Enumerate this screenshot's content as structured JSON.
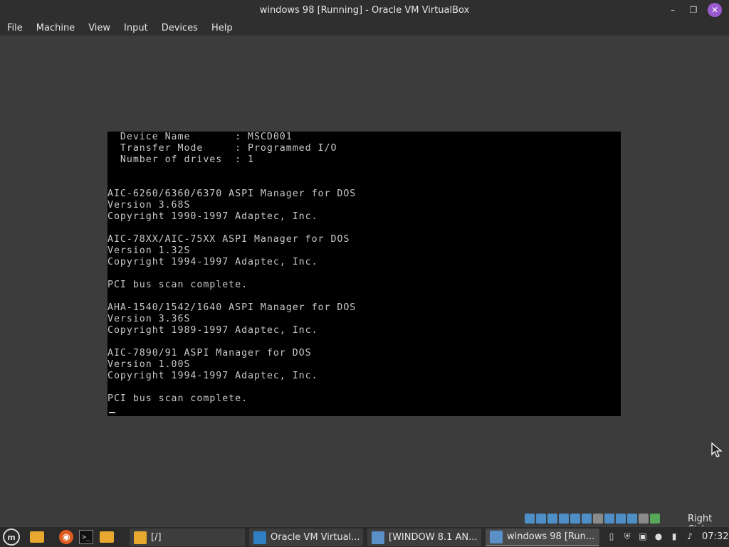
{
  "window": {
    "title": "windows 98 [Running] - Oracle VM VirtualBox",
    "minimize_glyph": "–",
    "maximize_glyph": "❐",
    "close_glyph": "✕"
  },
  "menu": [
    "File",
    "Machine",
    "View",
    "Input",
    "Devices",
    "Help"
  ],
  "dos_console": {
    "lines": [
      "  Device Name       : MSCD001",
      "  Transfer Mode     : Programmed I/O",
      "  Number of drives  : 1",
      "",
      "",
      "AIC-6260/6360/6370 ASPI Manager for DOS",
      "Version 3.68S",
      "Copyright 1990-1997 Adaptec, Inc.",
      "",
      "AIC-78XX/AIC-75XX ASPI Manager for DOS",
      "Version 1.32S",
      "Copyright 1994-1997 Adaptec, Inc.",
      "",
      "PCI bus scan complete.",
      "",
      "AHA-1540/1542/1640 ASPI Manager for DOS",
      "Version 3.36S",
      "Copyright 1989-1997 Adaptec, Inc.",
      "",
      "AIC-7890/91 ASPI Manager for DOS",
      "Version 1.00S",
      "Copyright 1994-1997 Adaptec, Inc.",
      "",
      "PCI bus scan complete."
    ]
  },
  "vm_status": {
    "indicator_icons": [
      "hard-disk-icon",
      "optical-drive-icon",
      "floppy-icon",
      "audio-icon",
      "network-icon",
      "usb-icon",
      "shared-folders-icon",
      "display-icon",
      "video-capture-icon",
      "virtualization-icon",
      "mouse-integration-icon",
      "keyboard-icon"
    ],
    "host_key": "Right Ctrl"
  },
  "taskbar": {
    "tasks": [
      {
        "label": "[/]"
      },
      {
        "label": "Oracle VM Virtual..."
      },
      {
        "label": "[WINDOW 8.1 AN..."
      },
      {
        "label": "windows 98 [Run..."
      }
    ],
    "clock": "07:32"
  },
  "colors": {
    "chrome_bg": "#2f2f2f",
    "guest_bg": "#3c3c3c",
    "console_bg": "#000000",
    "console_text": "#c8c8c8",
    "close_accent": "#9b59d0"
  }
}
